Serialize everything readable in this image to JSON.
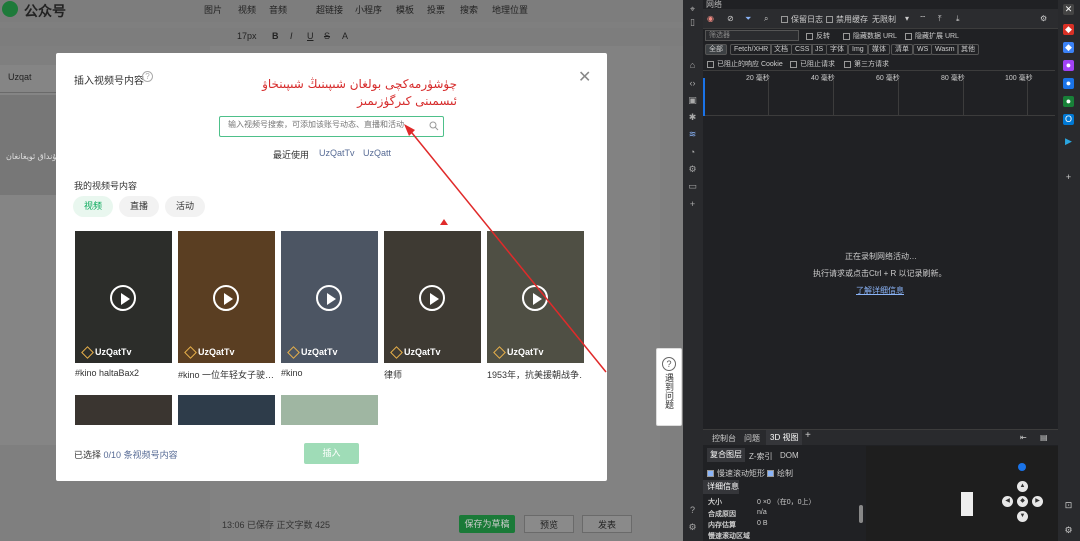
{
  "editor": {
    "brand": "公众号",
    "menus": [
      "图片",
      "视频",
      "音频",
      "超链接",
      "小程序",
      "模板",
      "投票",
      "搜索",
      "地理位置"
    ],
    "toolbar": [
      "17px",
      "B",
      "I",
      "U",
      "S",
      "A"
    ],
    "left_tab": "Uzqat",
    "left_thumb_text": "بىز مۇشۇنداق ئويغانغان",
    "status": "13:06 已保存   正文字数 425",
    "save_draft": "保存为草稿",
    "preview": "预览",
    "publish": "发表",
    "help_float": "遇到问题"
  },
  "modal": {
    "title": "插入视频号内容",
    "annotation": "چۈشۈرمەكچى بولغان شىپىنىڭ شىپىنخاۋ ئىسمىنى كىرگۈزىمىز",
    "search_placeholder": "输入视频号搜索，可添加该账号动态、直播和活动",
    "recent_label": "最近使用",
    "recent": [
      "UzQatTv",
      "UzQatt"
    ],
    "section_title": "我的视频号内容",
    "filters": [
      "视频",
      "直播",
      "活动"
    ],
    "cards": [
      {
        "tag": "UzQatTv",
        "title": "#kino haltaBax2",
        "color": "#2c2d2a"
      },
      {
        "tag": "UzQatTv",
        "title": "#kino 一位年轻女子驶…",
        "color": "#5a3e22"
      },
      {
        "tag": "UzQatTv",
        "title": "#kino",
        "color": "#4c5563"
      },
      {
        "tag": "UzQatTv",
        "title": "律师",
        "color": "#3e3a33"
      },
      {
        "tag": "UzQatTv",
        "title": "1953年，抗美援朝战争…",
        "color": "#4f4f44"
      }
    ],
    "row2_colors": [
      "#3a3530",
      "#2e3c4a",
      "#9fb6a2"
    ],
    "selected_prefix": "已选择",
    "selected_count": "0/10",
    "selected_suffix": "条视频号内容",
    "insert": "插入"
  },
  "devtools": {
    "window_title": "网络",
    "preserve_log": "保留日志",
    "disable_cache": "禁用缓存",
    "throttle": "无限制",
    "filter_placeholder": "筛选器",
    "invert": "反转",
    "hide_data_urls": "隐藏数据 URL",
    "hide_ext_urls": "隐藏扩展 URL",
    "types": [
      "全部",
      "Fetch/XHR",
      "文档",
      "CSS",
      "JS",
      "字体",
      "Img",
      "媒体",
      "清单",
      "WS",
      "Wasm",
      "其他"
    ],
    "blocked_cookies": "已阻止的响应 Cookie",
    "blocked_requests": "已阻止请求",
    "third_party": "第三方请求",
    "timeline_ticks": [
      "20 毫秒",
      "40 毫秒",
      "60 毫秒",
      "80 毫秒",
      "100 毫秒"
    ],
    "recording": "正在录制网络活动…",
    "hint": "执行请求或点击Ctrl + R 以记录刷新。",
    "learn_more": "了解详细信息",
    "drawer_tabs": [
      "控制台",
      "问题",
      "3D 视图"
    ],
    "sub_tabs": [
      "复合图层",
      "Z-索引",
      "DOM"
    ],
    "details_title": "详细信息",
    "rows": [
      {
        "k": "大小",
        "v": "0 ×0 （在0，0上）"
      },
      {
        "k": "合成原因",
        "v": "n/a"
      },
      {
        "k": "内存估算",
        "v": "0 B"
      },
      {
        "k": "慢速滚动区域",
        "v": ""
      }
    ],
    "slow_scroll": "慢速滚动矩形",
    "paint": "绘制"
  }
}
